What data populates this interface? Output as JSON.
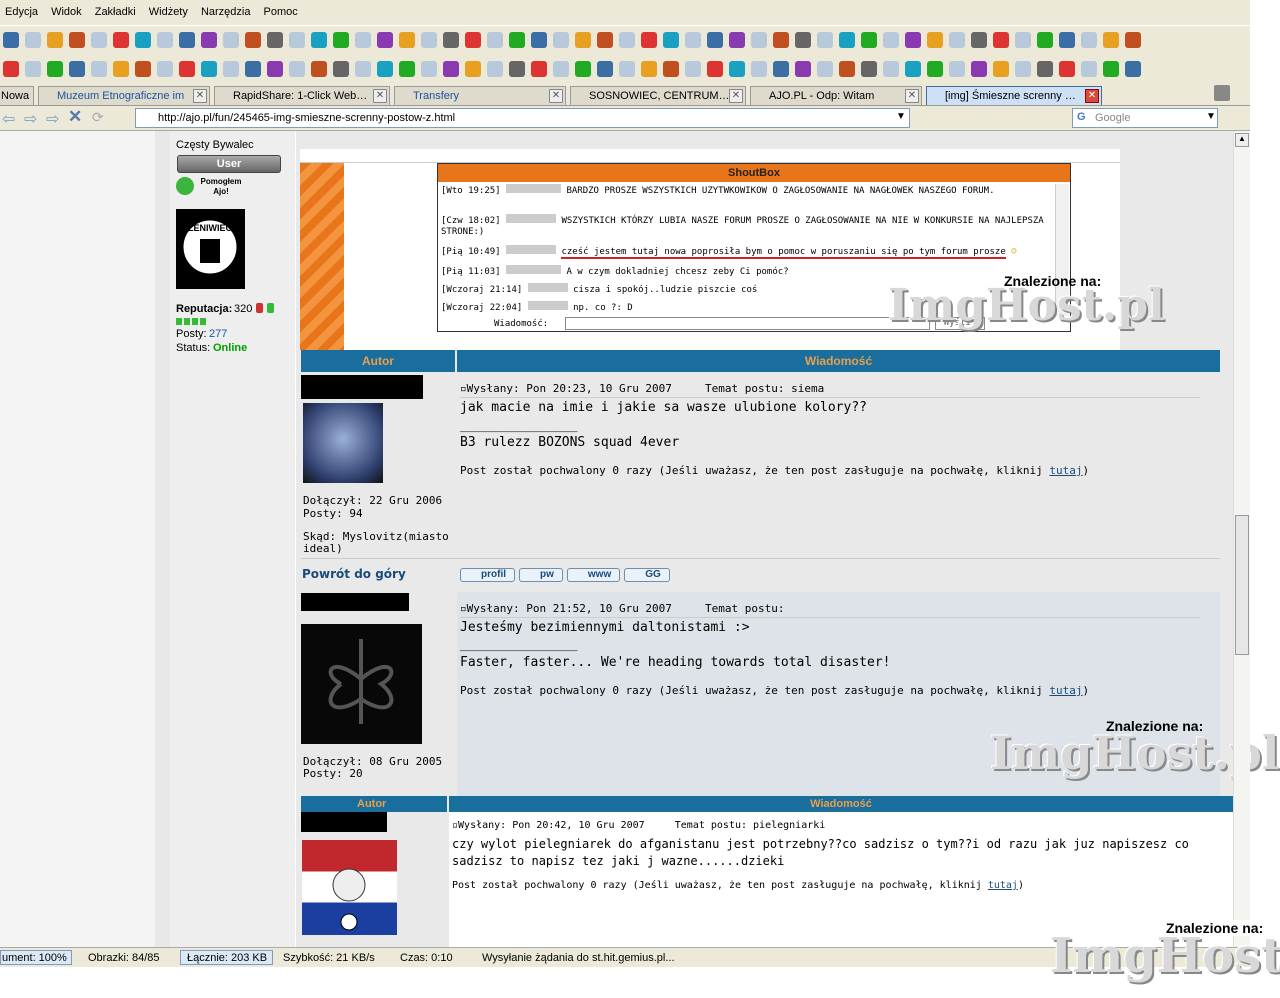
{
  "menu": [
    "Edycja",
    "Widok",
    "Zakładki",
    "Widżety",
    "Narzędzia",
    "Pomoc"
  ],
  "tabs": [
    {
      "label": "Nowa"
    },
    {
      "label": "Muzeum Etnograficzne im"
    },
    {
      "label": "RapidShare: 1-Click Web…"
    },
    {
      "label": "Transfery"
    },
    {
      "label": "SOSNOWIEC, CENTRUM…"
    },
    {
      "label": "AJO.PL - Odp: Witam"
    },
    {
      "label": "[img] Śmieszne screnny …"
    }
  ],
  "address": "http://ajo.pl/fun/245465-img-smieszne-screnny-postow-z.html",
  "search_placeholder": "Google",
  "profile": {
    "rank": "Częsty Bywalec",
    "badge": "User",
    "helped": "Pomogłem Ajo!",
    "reputation_label": "Reputacja:",
    "reputation": "320",
    "posts_label": "Posty:",
    "posts": "277",
    "status_label": "Status:",
    "status": "Online"
  },
  "shoutbox": {
    "title": "ShoutBox",
    "entries": [
      {
        "time": "[Wto 19:25]",
        "text": "BARDZO PROSZE WSZYSTKICH UZYTWKOWIKOW O ZAGŁOSOWANIE NA NAGŁOWEK NASZEGO FORUM."
      },
      {
        "time": "[Czw 18:02]",
        "text": "WSZYSTKICH KTÓRZY LUBIA NASZE FORUM PROSZE O ZAGŁOSOWANIE NA NIE W KONKURSIE NA NAJLEPSZA STRONE:)"
      },
      {
        "time": "[Pią 10:49]",
        "text": "cześć jestem tutaj nowa poprosiła bym o pomoc w poruszaniu się po tym forum prosze"
      },
      {
        "time": "[Pią 11:03]",
        "text": "A w czym dokladniej chcesz zeby Ci pomóc?"
      },
      {
        "time": "[Wczoraj 21:14]",
        "text": "cisza i spokój..ludzie piszcie coś"
      },
      {
        "time": "[Wczoraj 22:04]",
        "text": "np. co ?: D"
      }
    ],
    "input_label": "Wiadomość:",
    "send": "Wyślij"
  },
  "watermark": {
    "found": "Znalezione na:",
    "site": "ImgHost.pl"
  },
  "headers": {
    "author": "Autor",
    "message": "Wiadomość"
  },
  "posts": [
    {
      "meta": "Wysłany: Pon 20:23, 10 Gru 2007     Temat postu: siema",
      "body": "jak macie na imie i jakie sa wasze ulubione kolory??",
      "sig_line": "_______________",
      "sig": "B3 rulezz BOZONS squad 4ever",
      "praise": "Post został pochwalony 0 razy (Jeśli uważasz, że ten post zasługuje na pochwałę, kliknij ",
      "praise_link": "tutaj",
      "joined": "Dołączył: 22 Gru 2006",
      "posts": "Posty: 94",
      "from": "Skąd: Myslovitz(miasto ideal)"
    },
    {
      "meta": "Wysłany: Pon 21:52, 10 Gru 2007     Temat postu:",
      "body": "Jesteśmy bezimiennymi daltonistami :>",
      "sig_line": "_______________",
      "sig": "Faster, faster... We're heading towards total disaster!",
      "praise": "Post został pochwalony 0 razy (Jeśli uważasz, że ten post zasługuje na pochwałę, kliknij ",
      "praise_link": "tutaj",
      "joined": "Dołączył: 08 Gru 2005",
      "posts": "Posty: 20"
    },
    {
      "meta": "Wysłany: Pon 20:42, 10 Gru 2007     Temat postu: pielegniarki",
      "body": "czy wylot pielegniarek do afganistanu jest potrzebny??co sadzisz o tym??i od razu jak juz napiszesz co sadzisz to napisz tez jaki j wazne......dzieki",
      "praise": "Post został pochwalony 0 razy (Jeśli uważasz, że ten post zasługuje na pochwałę, kliknij ",
      "praise_link": "tutaj"
    }
  ],
  "back_to_top": "Powrót do góry",
  "buttons": [
    "profil",
    "pw",
    "www",
    "GG"
  ],
  "status": {
    "doc": "ument: 100%",
    "images": "Obrazki:   84/85",
    "total": "Łącznie:   203 KB",
    "speed": "Szybkość:   21 KB/s",
    "time": "Czas:   0:10",
    "msg": "Wysyłanie żądania do st.hit.gemius.pl..."
  },
  "colors": {
    "header_bg": "#1a6e9d",
    "header_text": "#e8a04a",
    "online": "#00a000",
    "link": "#1a4c7a"
  }
}
